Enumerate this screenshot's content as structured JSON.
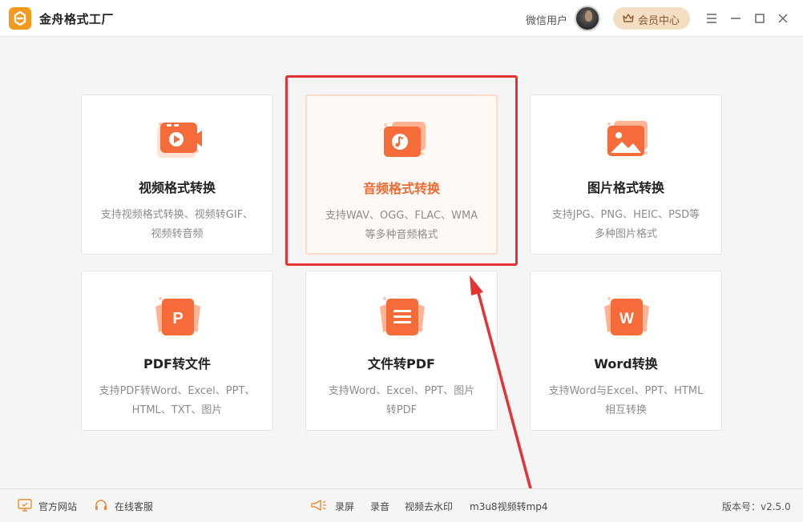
{
  "app": {
    "title": "金舟格式工厂"
  },
  "header": {
    "user_name": "微信用户",
    "vip_label": "会员中心"
  },
  "cards": [
    {
      "title": "视频格式转换",
      "desc": [
        "支持视频格式转换、视频转GIF、",
        "视频转音频"
      ]
    },
    {
      "title": "音频格式转换",
      "desc": [
        "支持WAV、OGG、FLAC、WMA",
        "等多种音频格式"
      ]
    },
    {
      "title": "图片格式转换",
      "desc": [
        "支持JPG、PNG、HEIC、PSD等",
        "多种图片格式"
      ]
    },
    {
      "title": "PDF转文件",
      "desc": [
        "支持PDF转Word、Excel、PPT、",
        "HTML、TXT、图片"
      ]
    },
    {
      "title": "文件转PDF",
      "desc": [
        "支持Word、Excel、PPT、图片",
        "转PDF"
      ]
    },
    {
      "title": "Word转换",
      "desc": [
        "支持Word与Excel、PPT、HTML",
        "相互转换"
      ]
    }
  ],
  "footer": {
    "website": "官方网站",
    "support": "在线客服",
    "record_screen": "录屏",
    "record_audio": "录音",
    "watermark": "视频去水印",
    "m3u8": "m3u8视频转mp4",
    "version": "版本号：v2.5.0"
  },
  "colors": {
    "accent": "#f06a33",
    "highlight_frame": "#e53232",
    "vip_bg": "#f3ddc3"
  }
}
